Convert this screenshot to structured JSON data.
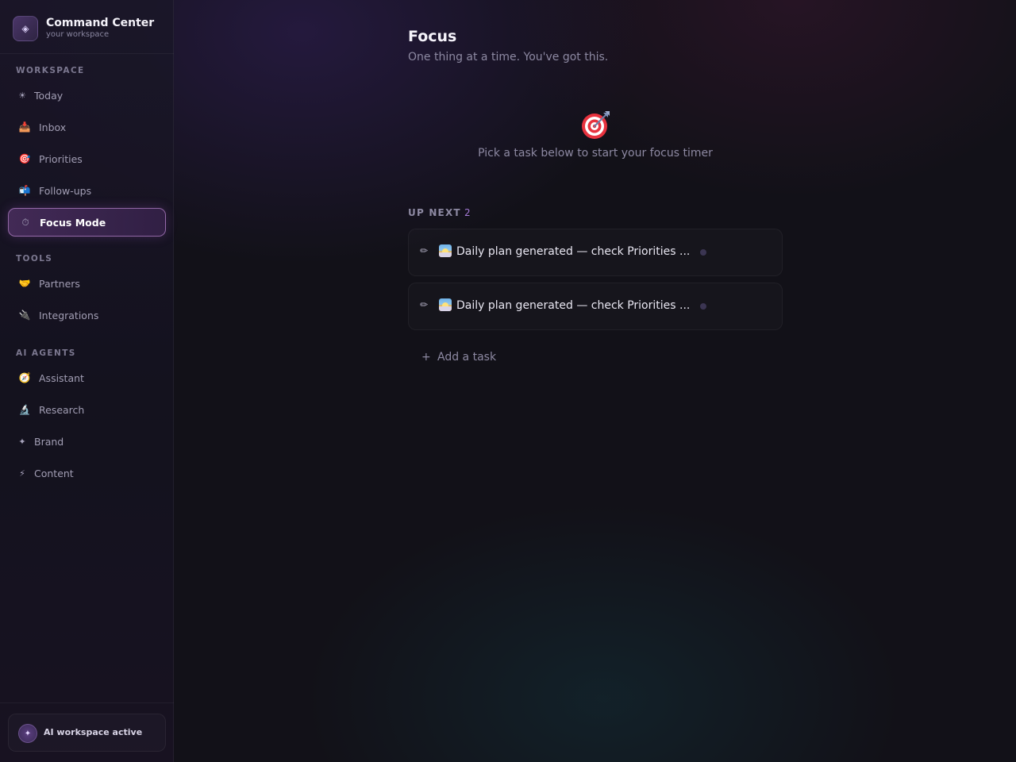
{
  "brand": {
    "title": "Command Center",
    "subtitle": "your workspace",
    "logo_icon": "diamond-icon"
  },
  "sidebar": {
    "sections": [
      {
        "label": "WORKSPACE",
        "items": [
          {
            "label": "Today",
            "icon": "sun-icon"
          },
          {
            "label": "Inbox",
            "icon": "inbox-tray-icon"
          },
          {
            "label": "Priorities",
            "icon": "target-icon"
          },
          {
            "label": "Follow-ups",
            "icon": "mailbox-icon"
          },
          {
            "label": "Focus Mode",
            "icon": "stopwatch-icon",
            "active": true
          }
        ]
      },
      {
        "label": "TOOLS",
        "items": [
          {
            "label": "Partners",
            "icon": "handshake-icon"
          },
          {
            "label": "Integrations",
            "icon": "plug-icon"
          }
        ]
      },
      {
        "label": "AI AGENTS",
        "items": [
          {
            "label": "Assistant",
            "icon": "compass-icon"
          },
          {
            "label": "Research",
            "icon": "microscope-icon"
          },
          {
            "label": "Brand",
            "icon": "sparkle-icon"
          },
          {
            "label": "Content",
            "icon": "lightning-icon"
          }
        ]
      }
    ],
    "status": "AI workspace active"
  },
  "main": {
    "title": "Focus",
    "subtitle": "One thing at a time. You've got this.",
    "hero_text": "Pick a task below to start your focus timer",
    "up_next": {
      "label": "UP NEXT",
      "count": "2",
      "tasks": [
        {
          "title": "Daily plan generated — check Priorities ..."
        },
        {
          "title": "Daily plan generated — check Priorities ..."
        }
      ]
    },
    "add_task_label": "Add a task"
  },
  "colors": {
    "background": "#121118",
    "accent": "#a47ad6",
    "active_border": "#dca0f0"
  }
}
